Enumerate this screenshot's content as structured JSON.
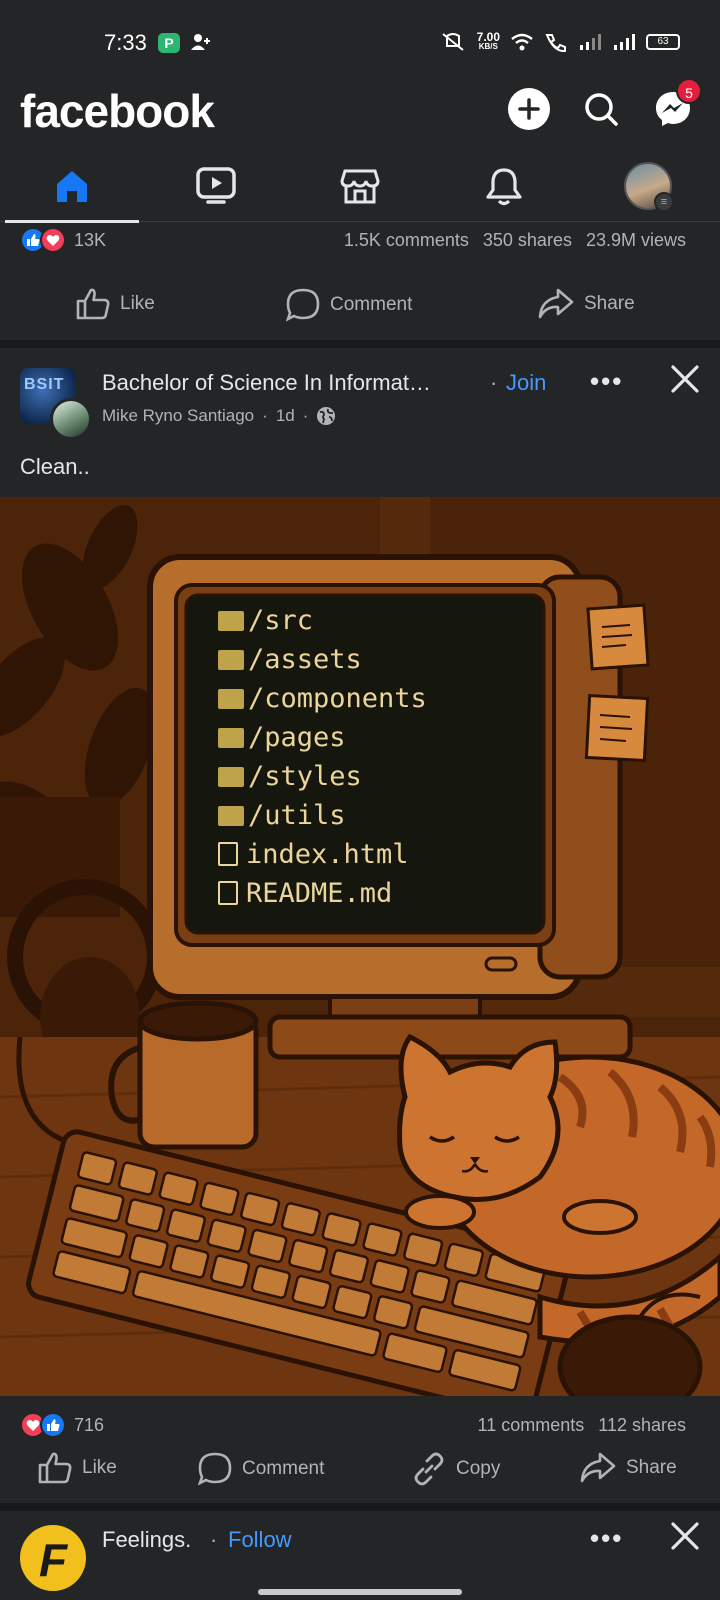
{
  "status_bar": {
    "time": "7:33",
    "app_icon_label": "P",
    "speed_value": "7.00",
    "speed_unit": "KB/S",
    "battery": "63"
  },
  "header": {
    "logo": "facebook",
    "messenger_badge": "5"
  },
  "tabs": [
    {
      "name": "home",
      "icon": "home-icon",
      "active": true
    },
    {
      "name": "video",
      "icon": "video-icon",
      "active": false
    },
    {
      "name": "marketplace",
      "icon": "marketplace-icon",
      "active": false
    },
    {
      "name": "notifications",
      "icon": "bell-icon",
      "active": false
    },
    {
      "name": "profile",
      "icon": "avatar",
      "active": false
    }
  ],
  "post1": {
    "reactions_count": "13K",
    "comments": "1.5K comments",
    "shares": "350 shares",
    "views": "23.9M views",
    "like_label": "Like",
    "comment_label": "Comment",
    "share_label": "Share"
  },
  "post2": {
    "group_name": "Bachelor of Science In Informat…",
    "join_label": "Join",
    "author": "Mike Ryno Santiago",
    "time": "1d",
    "caption": "Clean..",
    "image_text": {
      "folders": [
        "/src",
        "/assets",
        "/components",
        "/pages",
        "/styles",
        "/utils"
      ],
      "files": [
        "index.html",
        "README.md"
      ]
    },
    "reactions_count": "716",
    "comments": "11 comments",
    "shares": "112 shares",
    "like_label": "Like",
    "comment_label": "Comment",
    "copy_label": "Copy",
    "share_label": "Share"
  },
  "post3": {
    "page_name": "Feelings.",
    "follow_label": "Follow",
    "avatar_letter": "F"
  },
  "colors": {
    "background": "#242526",
    "accent_blue": "#1877f2",
    "link_blue": "#4599ff",
    "badge_red": "#e41e3f",
    "love_red": "#f33e58"
  }
}
